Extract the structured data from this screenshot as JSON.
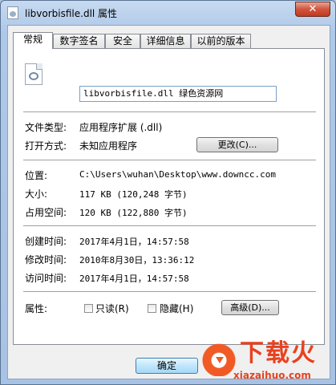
{
  "window": {
    "title": "libvorbisfile.dll 属性",
    "close_glyph": "✕"
  },
  "tabs": [
    "常规",
    "数字签名",
    "安全",
    "详细信息",
    "以前的版本"
  ],
  "general": {
    "filename": "libvorbisfile.dll 绿色资源网",
    "file_type_label": "文件类型:",
    "file_type_value": "应用程序扩展 (.dll)",
    "open_with_label": "打开方式:",
    "open_with_value": "未知应用程序",
    "change_button": "更改(C)...",
    "location_label": "位置:",
    "location_value": "C:\\Users\\wuhan\\Desktop\\www.downcc.com",
    "size_label": "大小:",
    "size_value": "117 KB (120,248 字节)",
    "disk_label": "占用空间:",
    "disk_value": "120 KB (122,880 字节)",
    "created_label": "创建时间:",
    "created_value": "2017年4月1日，14:57:58",
    "modified_label": "修改时间:",
    "modified_value": "2010年8月30日，13:36:12",
    "accessed_label": "访问时间:",
    "accessed_value": "2017年4月1日，14:57:58",
    "attributes_label": "属性:",
    "readonly_label": "只读(R)",
    "hidden_label": "隐藏(H)",
    "advanced_button": "高级(D)..."
  },
  "buttons": {
    "ok": "确定"
  },
  "watermark": {
    "brand": "下载火",
    "url": "xiazaihuo.com"
  }
}
